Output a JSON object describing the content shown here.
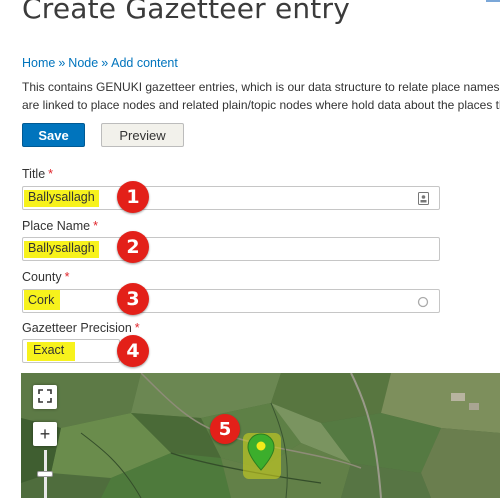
{
  "page": {
    "title": "Create Gazetteer entry"
  },
  "breadcrumb": {
    "items": [
      "Home",
      "Node",
      "Add content"
    ],
    "separator": "»"
  },
  "description": {
    "line1": "This contains GENUKI gazetteer entries, which is our data structure to relate place names to",
    "line2": "are linked to place nodes and related plain/topic nodes where hold data about the places th"
  },
  "actions": {
    "save_label": "Save",
    "preview_label": "Preview"
  },
  "form": {
    "title": {
      "label": "Title",
      "required_mark": "*",
      "value": "Ballysallagh",
      "badge": "1",
      "icon": "contact-card-icon"
    },
    "place_name": {
      "label": "Place Name",
      "required_mark": "*",
      "value": "Ballysallagh",
      "badge": "2"
    },
    "county": {
      "label": "County",
      "required_mark": "*",
      "value": "Cork",
      "badge": "3",
      "icon": "autocomplete-throbber-icon"
    },
    "precision": {
      "label": "Gazetteer Precision",
      "required_mark": "*",
      "value": "Exact",
      "badge": "4"
    }
  },
  "map": {
    "badge": "5",
    "zoom_in_label": "+",
    "marker_icon": "map-pin-icon",
    "fullscreen_icon": "fullscreen-icon"
  },
  "colors": {
    "link": "#0074bd",
    "save_button": "#0074bd",
    "required": "#e0252b",
    "badge": "#e32019",
    "highlight": "#f7f21c",
    "marker": "#3cae2c"
  }
}
